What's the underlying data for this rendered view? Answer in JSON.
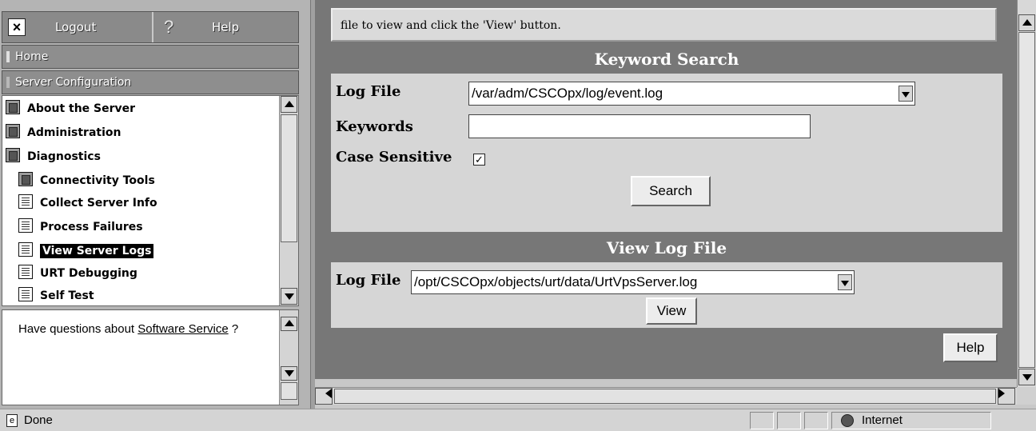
{
  "topbar": {
    "logout_label": "Logout",
    "help_label": "Help",
    "help_symbol": "?"
  },
  "nav": {
    "home_label": "Home",
    "server_config_label": "Server Configuration"
  },
  "tree": {
    "items": [
      {
        "label": "About the Server",
        "icon": "folder-icon"
      },
      {
        "label": "Administration",
        "icon": "folder-icon"
      },
      {
        "label": "Diagnostics",
        "icon": "open-folder-icon"
      },
      {
        "label": "Connectivity Tools",
        "icon": "folder-icon"
      },
      {
        "label": "Collect Server Info",
        "icon": "document-icon"
      },
      {
        "label": "Process Failures",
        "icon": "document-icon"
      },
      {
        "label": "View Server Logs",
        "icon": "document-icon"
      },
      {
        "label": "URT Debugging",
        "icon": "document-icon"
      },
      {
        "label": "Self Test",
        "icon": "document-icon"
      }
    ]
  },
  "help_box": {
    "prefix": "Have questions about ",
    "link_text": "Software Service",
    "suffix": " ?"
  },
  "intro_text": "file to view and click the 'View' button.",
  "keyword_search": {
    "title": "Keyword Search",
    "log_file_label": "Log File",
    "log_file_value": "/var/adm/CSCOpx/log/event.log",
    "keywords_label": "Keywords",
    "keywords_value": "",
    "case_sensitive_label": "Case Sensitive",
    "case_sensitive_checked": "✓",
    "search_button": "Search"
  },
  "view_log": {
    "title": "View Log File",
    "log_file_label": "Log File",
    "log_file_value": "/opt/CSCOpx/objects/urt/data/UrtVpsServer.log",
    "view_button": "View"
  },
  "help_button": "Help",
  "status": {
    "text": "Done",
    "zone": "Internet"
  }
}
